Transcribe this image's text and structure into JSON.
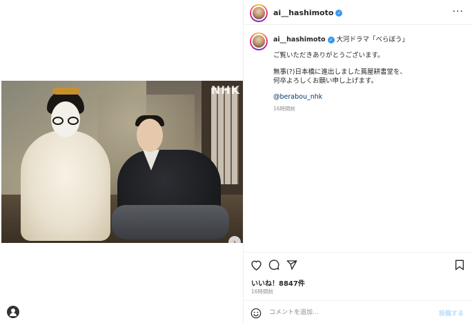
{
  "media": {
    "watermark": "NHK",
    "carousel_next_glyph": "›"
  },
  "post": {
    "username": "ai__hashimoto",
    "verified_glyph": "✓",
    "more_glyph": "···",
    "caption": {
      "title": "大河ドラマ「べらぼう」",
      "line_thanks": "ご覧いただきありがとうございます。",
      "line_news1": "無事(?)日本橋に進出しました蔦屋耕書堂を、",
      "line_news2": "何卒よろしくお願い申し上げます。",
      "mention": "@berabou_nhk",
      "time": "16時間前"
    },
    "likes_text": "いいね！8847件",
    "time": "16時間前"
  },
  "comment_box": {
    "placeholder": "コメントを追加...",
    "post_label": "投稿する"
  },
  "icons": {
    "heart": "heart-icon",
    "comment": "comment-icon",
    "share": "share-icon",
    "bookmark": "bookmark-icon",
    "emoji": "emoji-icon",
    "more": "more-icon",
    "user": "user-icon"
  },
  "colors": {
    "verified": "#3897f0",
    "mention": "#00376b",
    "secondary_text": "#8e8e8e",
    "post_button": "#b2dffc"
  }
}
